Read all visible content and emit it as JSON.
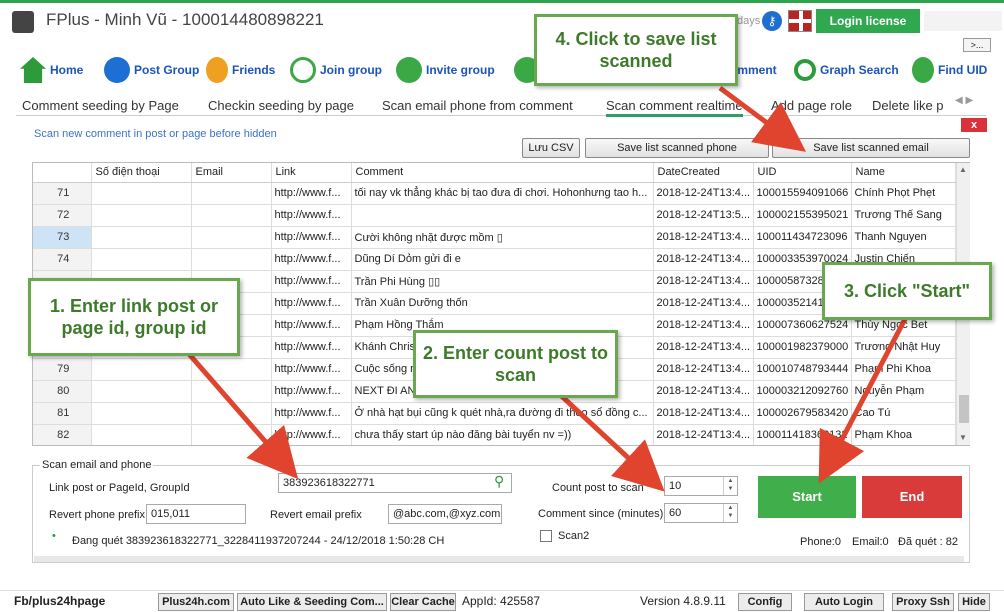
{
  "window": {
    "title": "FPlus - Minh Vũ - 100014480898221",
    "days": "days",
    "login_license": "Login license",
    "more": ">..."
  },
  "toolbar": {
    "items": [
      {
        "label": "Home",
        "icon": "home-icon"
      },
      {
        "label": "Post Group",
        "icon": "group-icon"
      },
      {
        "label": "Friends",
        "icon": "friends-icon"
      },
      {
        "label": "Join group",
        "icon": "join-group-icon"
      },
      {
        "label": "Invite group",
        "icon": "add-user-icon"
      },
      {
        "label": "omment",
        "icon": "comment-icon"
      },
      {
        "label": "Graph Search",
        "icon": "search-icon"
      },
      {
        "label": "Find UID",
        "icon": "find-user-icon"
      }
    ]
  },
  "tabs": [
    "Comment seeding by Page",
    "Checkin seeding by page",
    "Scan email phone from comment",
    "Scan comment realtime",
    "Add page role",
    "Delete like p"
  ],
  "panel": {
    "title": "Scan new comment in post or page before hidden",
    "close": "x",
    "btn_save_csv": "Lưu CSV",
    "btn_save_phone": "Save list scanned phone",
    "btn_save_email": "Save list scanned email"
  },
  "table": {
    "columns": [
      "",
      "Số điện thoại",
      "Email",
      "Link",
      "Comment",
      "DateCreated",
      "UID",
      "Name"
    ],
    "rows": [
      [
        "71",
        "",
        "",
        "http://www.f...",
        "tối nay vk thẳng khác bị tao đưa đi chơi. Hohonhưng tao h...",
        "2018-12-24T13:4...",
        "100015594091066",
        "Chính Phọt Phẹt"
      ],
      [
        "72",
        "",
        "",
        "http://www.f...",
        "",
        "2018-12-24T13:5...",
        "100002155395021",
        "Trương Thế Sang"
      ],
      [
        "73",
        "",
        "",
        "http://www.f...",
        "Cười không nhặt được mồm ▯",
        "2018-12-24T13:4...",
        "100011434723096",
        "Thanh Nguyen"
      ],
      [
        "74",
        "",
        "",
        "http://www.f...",
        "Dũng Dí Dỏm gửi đi e",
        "2018-12-24T13:4...",
        "100003353970024",
        "Justin Chiến"
      ],
      [
        "",
        "",
        "",
        "http://www.f...",
        "Trần Phi Hùng ▯▯",
        "2018-12-24T13:4...",
        "100005873281",
        ""
      ],
      [
        "",
        "",
        "",
        "http://www.f...",
        "Trần Xuân Dưỡng thốn",
        "2018-12-24T13:4...",
        "10000352141",
        ""
      ],
      [
        "",
        "",
        "",
        "http://www.f...",
        "Phạm Hồng Thắm",
        "2018-12-24T13:4...",
        "100007360627524",
        "Thùy Ngọc Bet"
      ],
      [
        "",
        "",
        "",
        "http://www.f...",
        "Khánh Chris",
        "2018-12-24T13:4...",
        "100001982379000",
        "Trương Nhật Huy"
      ],
      [
        "79",
        "",
        "",
        "http://www.f...",
        "Cuộc sống n",
        "2018-12-24T13:4...",
        "100010748793444",
        "Phạm Phi Khoa"
      ],
      [
        "80",
        "",
        "",
        "http://www.f...",
        "NEXT ĐI AN",
        "2018-12-24T13:4...",
        "100003212092760",
        "Nguyễn Phạm"
      ],
      [
        "81",
        "",
        "",
        "http://www.f...",
        "Ở nhà hạt bụi cũng k quét nhà,ra đường đi theo sổ đồng c...",
        "2018-12-24T13:4...",
        "100002679583420",
        "Cao Tú"
      ],
      [
        "82",
        "",
        "",
        "http://www.f...",
        "chưa thấy start úp nào đăng bài tuyển nv =))",
        "2018-12-24T13:4...",
        "100011418368132",
        "Phạm Khoa"
      ]
    ],
    "selected_row": 2
  },
  "scan": {
    "group_title": "Scan email and phone",
    "link_label": "Link post or PageId, GroupId",
    "link_value": "383923618322771",
    "revert_phone_label": "Revert phone prefix",
    "revert_phone_value": "015,011",
    "revert_email_label": "Revert email prefix",
    "revert_email_value": "@abc.com,@xyz.com",
    "count_label": "Count post to scan",
    "count_value": "10",
    "since_label": "Comment since (minutes)",
    "since_value": "60",
    "scan2_label": "Scan2",
    "status": "Đang quét 383923618322771_3228411937207244 - 24/12/2018 1:50:28 CH",
    "start": "Start",
    "end": "End",
    "phone_count": "Phone:0",
    "email_count": "Email:0",
    "scanned": "Đã quét : 82"
  },
  "statusbar": {
    "fb": "Fb/plus24hpage",
    "plus24h": "Plus24h.com",
    "auto_like": "Auto Like & Seeding Com...",
    "clear_cache": "Clear Cache",
    "appid": "AppId: 425587",
    "version": "Version 4.8.9.11",
    "config": "Config",
    "auto_login": "Auto Login",
    "proxy_ssh": "Proxy Ssh",
    "hide": "Hide"
  },
  "callouts": {
    "c1": "1. Enter link post or page id, group id",
    "c2": "2. Enter count post to scan",
    "c3": "3. Click \"Start\"",
    "c4": "4. Click to save list scanned"
  },
  "colors": {
    "accent_green": "#2fa84f",
    "start_green": "#3fae4b",
    "end_red": "#d93a3a",
    "toolbar_blue": "#1b54b8",
    "callout_green": "#6aa84f",
    "arrow_red": "#e0442e"
  }
}
